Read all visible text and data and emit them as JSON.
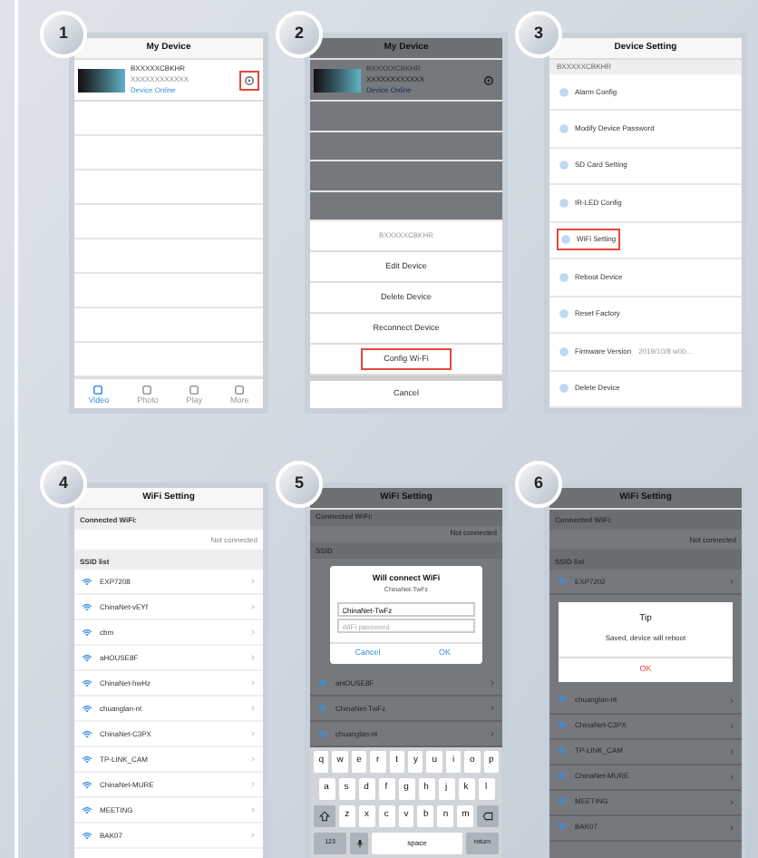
{
  "panels": [
    {
      "badge": "1",
      "kind": "device_list",
      "dimmed": false,
      "title": "My Device",
      "device": {
        "name": "BXXXXXCBKHR",
        "id": "XXXXXXXXXXXX",
        "status": "Device Online"
      },
      "gear_highlighted": true,
      "tabs": [
        {
          "label": "Video",
          "selected": true
        },
        {
          "label": "Photo",
          "selected": false
        },
        {
          "label": "Play",
          "selected": false
        },
        {
          "label": "More",
          "selected": false
        }
      ]
    },
    {
      "badge": "2",
      "kind": "action_sheet",
      "dimmed": true,
      "title": "My Device",
      "device": {
        "name": "BXXXXXCBKHR",
        "id": "XXXXXXXXXXXX",
        "status": "Device Online"
      },
      "sheet_header": "BXXXXXCBKHR",
      "actions": [
        {
          "label": "Edit Device",
          "highlighted": false
        },
        {
          "label": "Delete Device",
          "highlighted": false
        },
        {
          "label": "Reconnect Device",
          "highlighted": false
        },
        {
          "label": "Config Wi-Fi",
          "highlighted": true
        }
      ],
      "cancel": "Cancel"
    },
    {
      "badge": "3",
      "kind": "settings",
      "dimmed": false,
      "title": "Device Setting",
      "section": "BXXXXXCBKHR",
      "items": [
        {
          "label": "Alarm Config",
          "highlighted": false
        },
        {
          "label": "Modify Device Password",
          "highlighted": false
        },
        {
          "label": "SD Card Setting",
          "highlighted": false
        },
        {
          "label": "IR-LED Config",
          "highlighted": false
        },
        {
          "label": "WiFi Setting",
          "highlighted": true
        },
        {
          "label": "Reboot Device",
          "highlighted": false
        },
        {
          "label": "Reset Factory",
          "highlighted": false
        },
        {
          "label": "Firmware Version",
          "value": "2019/10/8 w00...",
          "highlighted": false
        },
        {
          "label": "Delete Device",
          "highlighted": false
        }
      ]
    },
    {
      "badge": "4",
      "kind": "wifi",
      "dimmed": false,
      "title": "WiFi Setting",
      "connected_label": "Connected WiFi:",
      "connected_value": "Not connected",
      "list_header": "SSID list",
      "networks_above": [
        "EXP7208",
        "ChinaNet-vEYf",
        "cbm",
        "aHOUSE8F",
        "ChinaNet-hwHz",
        "chuanglan-nt",
        "ChinaNet-C3PX",
        "TP-LINK_CAM",
        "ChinaNet-MURE",
        "MEETING",
        "BAK07"
      ]
    },
    {
      "badge": "5",
      "kind": "wifi",
      "dimmed": true,
      "title": "WiFi Setting",
      "connected_label": "Connected WiFi:",
      "connected_value": "Not connected",
      "list_header": "SSID",
      "dialog": {
        "kind": "password",
        "title": "Will connect WiFi",
        "subtitle": "ChinaNet-TwFz",
        "ssid_value": "ChinaNet-TwFz",
        "password_placeholder": "WiFi password",
        "buttons": [
          "Cancel",
          "OK"
        ]
      },
      "networks_below": [
        "aHOUSE8F",
        "ChinaNet-TwFz",
        "chuanglan-nt"
      ],
      "keyboard": [
        [
          {
            "kind": "letter",
            "label": "q"
          },
          {
            "kind": "letter",
            "label": "w"
          },
          {
            "kind": "letter",
            "label": "e"
          },
          {
            "kind": "letter",
            "label": "r"
          },
          {
            "kind": "letter",
            "label": "t"
          },
          {
            "kind": "letter",
            "label": "y"
          },
          {
            "kind": "letter",
            "label": "u"
          },
          {
            "kind": "letter",
            "label": "i"
          },
          {
            "kind": "letter",
            "label": "o"
          },
          {
            "kind": "letter",
            "label": "p"
          }
        ],
        [
          {
            "kind": "letter",
            "label": "a"
          },
          {
            "kind": "letter",
            "label": "s"
          },
          {
            "kind": "letter",
            "label": "d"
          },
          {
            "kind": "letter",
            "label": "f"
          },
          {
            "kind": "letter",
            "label": "g"
          },
          {
            "kind": "letter",
            "label": "h"
          },
          {
            "kind": "letter",
            "label": "j"
          },
          {
            "kind": "letter",
            "label": "k"
          },
          {
            "kind": "letter",
            "label": "l"
          }
        ],
        [
          {
            "kind": "shift"
          },
          {
            "kind": "letter",
            "label": "z"
          },
          {
            "kind": "letter",
            "label": "x"
          },
          {
            "kind": "letter",
            "label": "c"
          },
          {
            "kind": "letter",
            "label": "v"
          },
          {
            "kind": "letter",
            "label": "b"
          },
          {
            "kind": "letter",
            "label": "n"
          },
          {
            "kind": "letter",
            "label": "m"
          },
          {
            "kind": "delete"
          }
        ],
        [
          {
            "kind": "wide",
            "label": "123"
          },
          {
            "kind": "mic"
          },
          {
            "kind": "space",
            "label": "space"
          },
          {
            "kind": "wide",
            "label": "return"
          }
        ]
      ]
    },
    {
      "badge": "6",
      "kind": "wifi",
      "dimmed": true,
      "title": "WiFi Setting",
      "connected_label": "Connected WiFi:",
      "connected_value": "Not connected",
      "list_header": "SSID list",
      "networks_above": [
        "EXP7202"
      ],
      "dialog": {
        "kind": "tip",
        "title": "Tip",
        "message": "Saved, device will reboot",
        "buttons": [
          "OK"
        ]
      },
      "networks_below": [
        "chuanglan-nt",
        "ChinaNet-C3PX",
        "TP-LINK_CAM",
        "ChinaNet-MURE",
        "MEETING",
        "BAK07"
      ]
    }
  ]
}
